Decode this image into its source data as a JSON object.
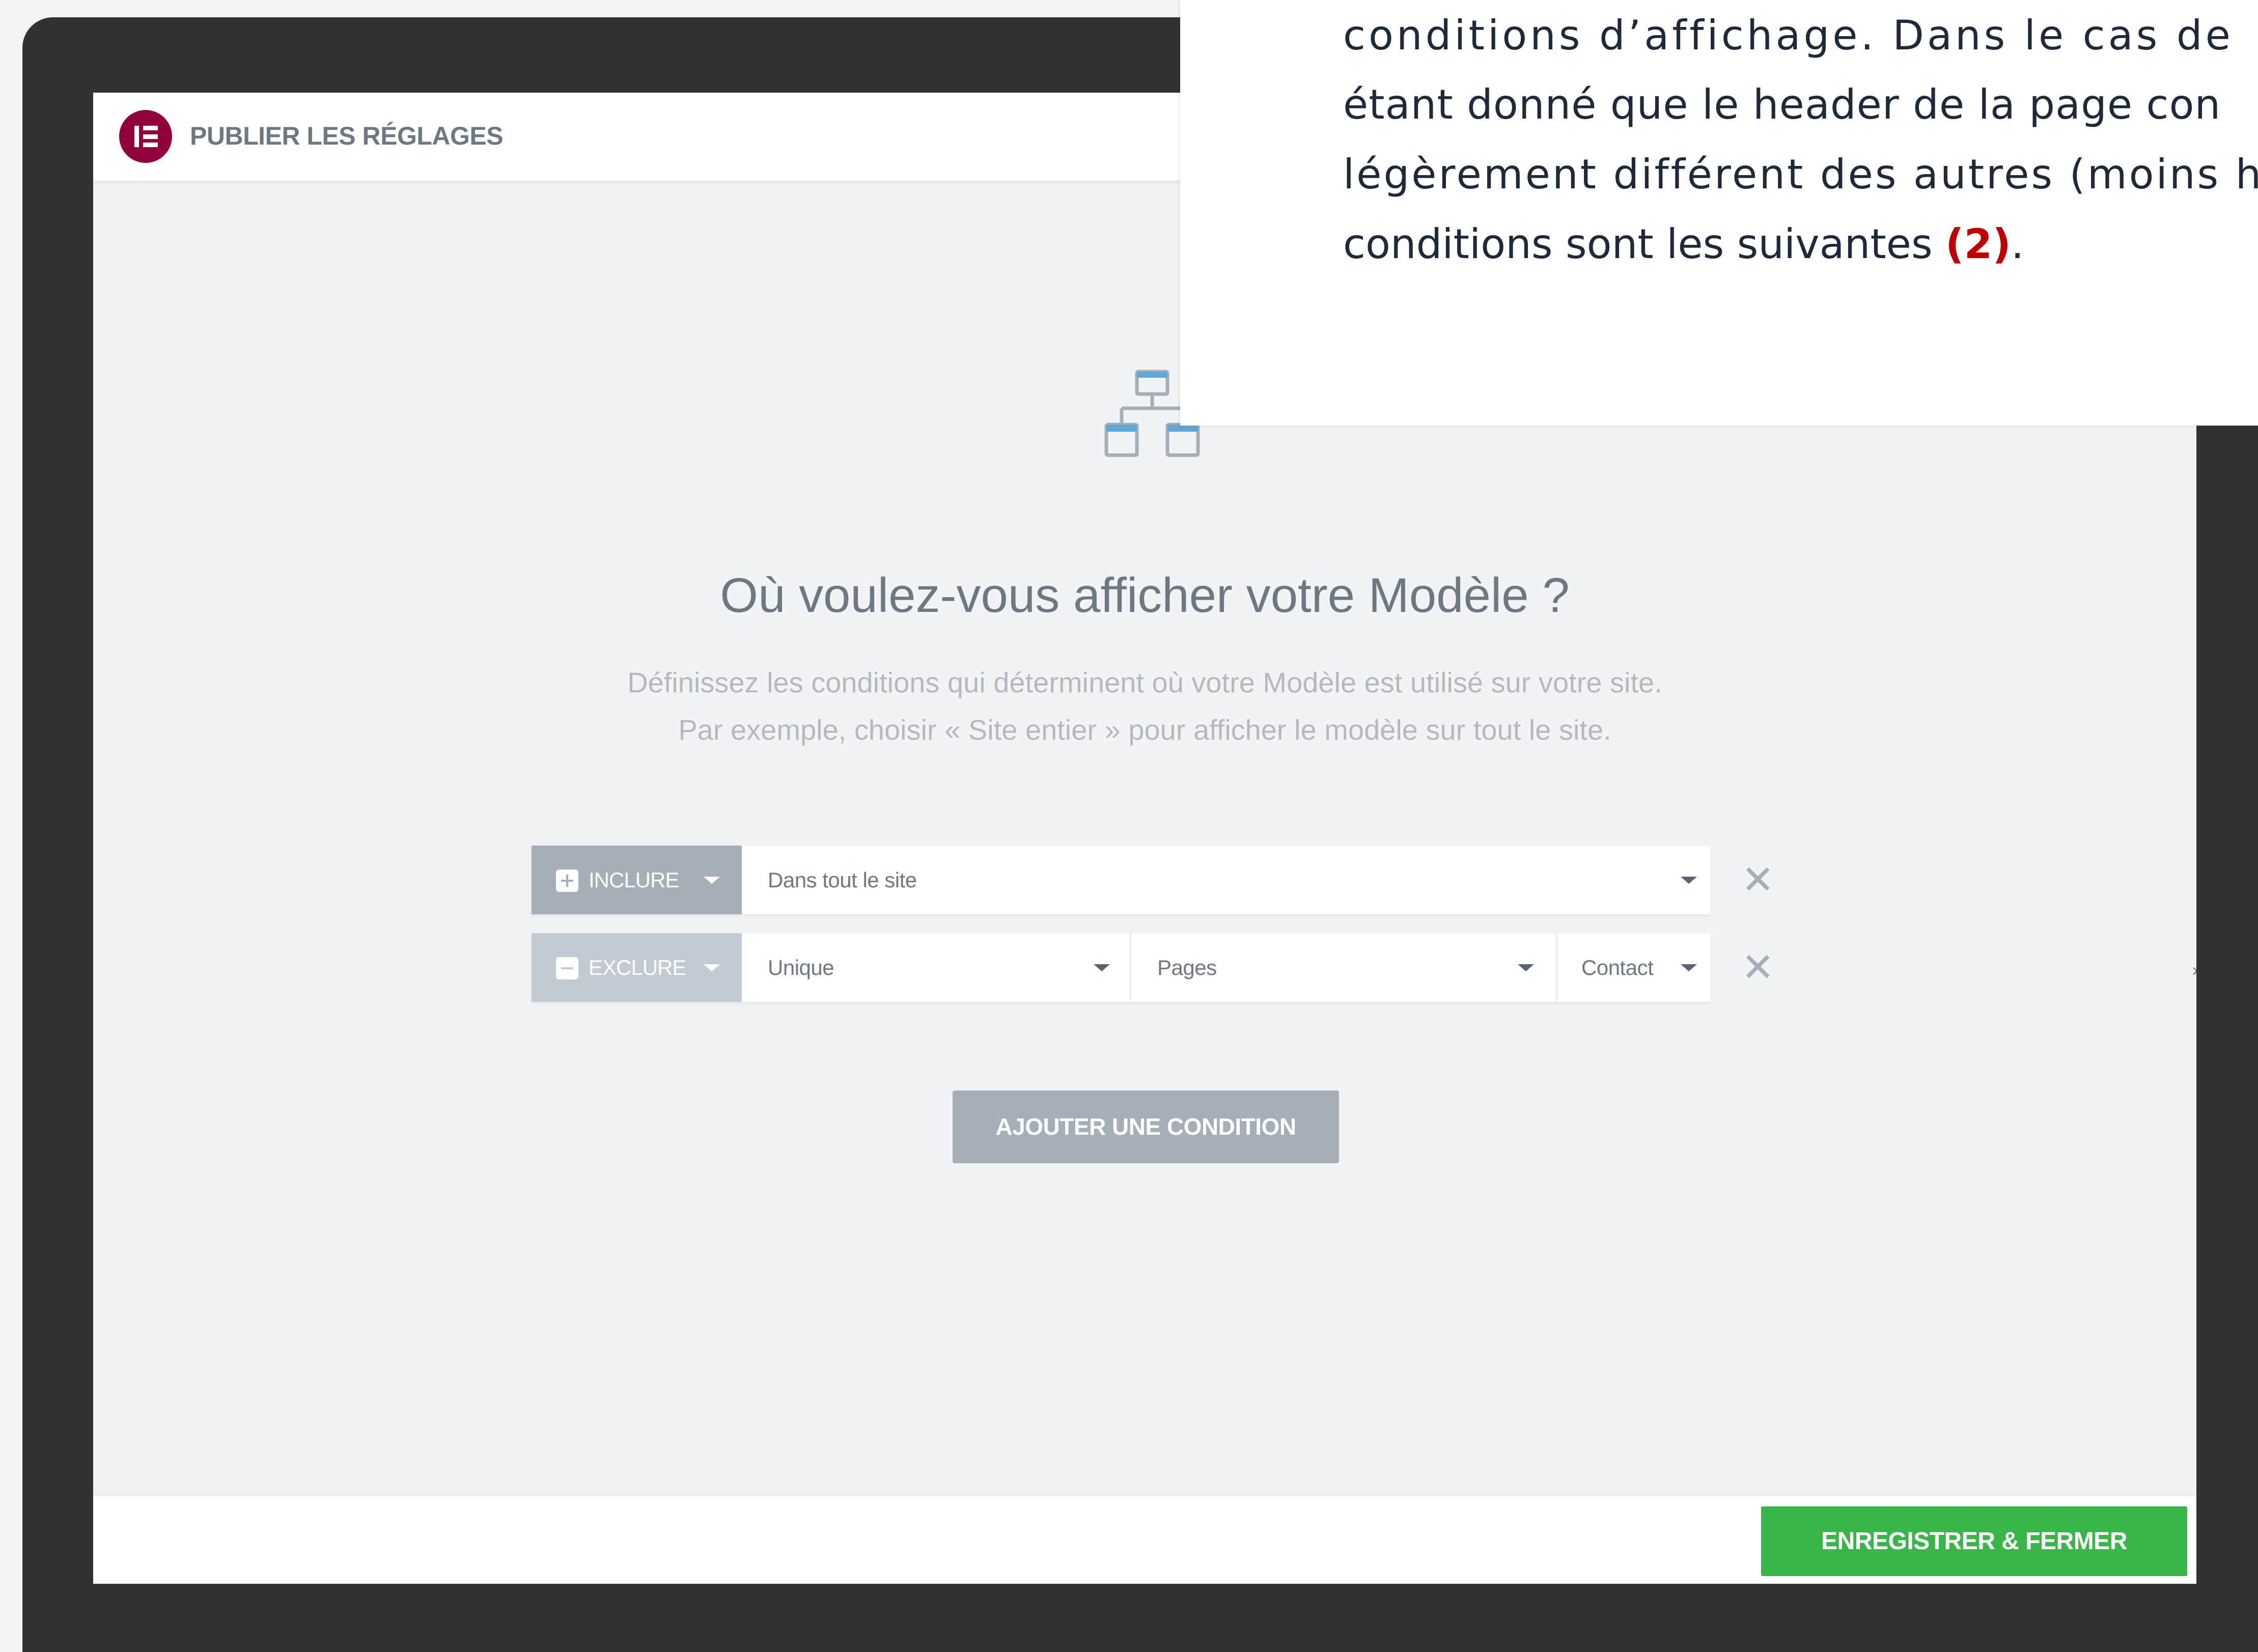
{
  "dialog": {
    "header_title": "PUBLIER LES RÉGLAGES",
    "title": "Où voulez-vous afficher votre Modèle ?",
    "description_line1": "Définissez les conditions qui déterminent où votre Modèle est utilisé sur votre site.",
    "description_line2": "Par exemple, choisir « Site entier » pour afficher le modèle sur tout le site.",
    "conditions": [
      {
        "type": "INCLURE",
        "selects": [
          "Dans tout le site"
        ]
      },
      {
        "type": "EXCLURE",
        "selects": [
          "Unique",
          "Pages",
          "Contact"
        ],
        "clear_symbol": "×"
      }
    ],
    "remove_symbol": "✕",
    "add_condition_label": "AJOUTER UNE CONDITION",
    "save_label": "ENREGISTRER & FERMER"
  },
  "overlay_text": {
    "line1": "conditions d’affichage. Dans le cas de",
    "line2": "étant donné que le header de la page con",
    "line3": "légèrement différent des autres (moins ha",
    "line4_start": "conditions sont les suivantes ",
    "line4_mark": "(2)",
    "line4_end": "."
  },
  "colors": {
    "brand_logo": "#92003b",
    "save_button": "#39b54a",
    "include_button": "#a4afb7",
    "exclude_button": "#c2cbd2",
    "annotation_mark": "#c00000"
  },
  "icons": {
    "logo": "elementor-logo-icon",
    "header": "sitemap-icon",
    "include": "plus-square-icon",
    "exclude": "minus-square-icon"
  }
}
